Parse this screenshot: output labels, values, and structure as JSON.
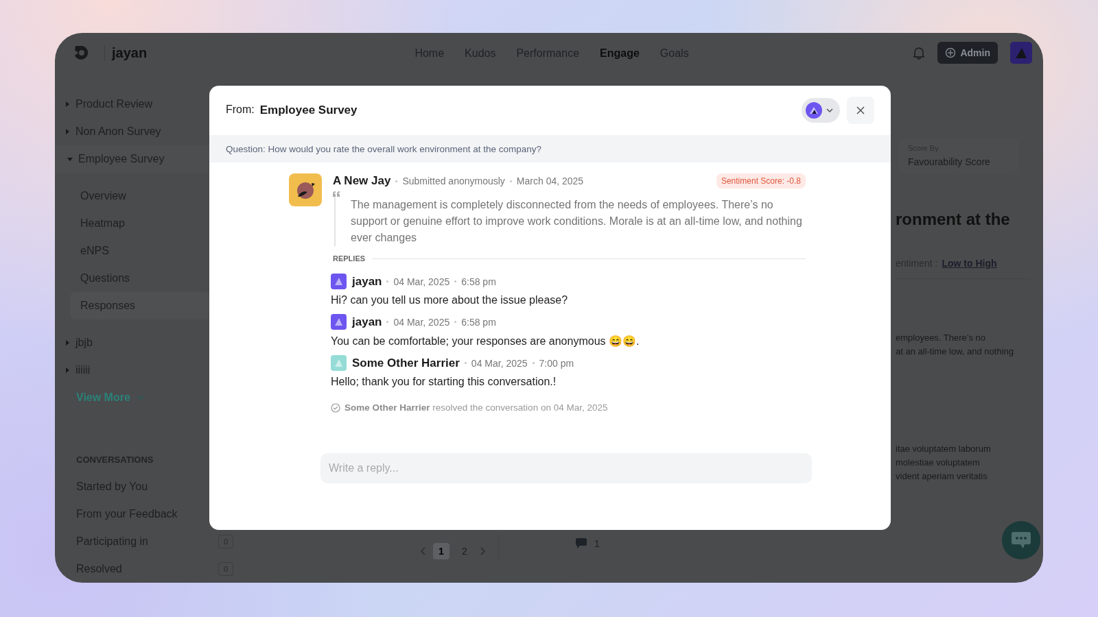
{
  "app": {
    "name": "jayan"
  },
  "nav": [
    {
      "label": "Home",
      "selected": false
    },
    {
      "label": "Kudos",
      "selected": false
    },
    {
      "label": "Performance",
      "selected": false
    },
    {
      "label": "Engage",
      "selected": true
    },
    {
      "label": "Goals",
      "selected": false
    }
  ],
  "admin_button": {
    "label": "Admin"
  },
  "sidebar": {
    "surveys": [
      {
        "label": "Product Review",
        "expanded": false
      },
      {
        "label": "Non Anon Survey",
        "expanded": false
      },
      {
        "label": "Employee Survey",
        "expanded": true,
        "children": [
          {
            "label": "Overview",
            "selected": false
          },
          {
            "label": "Heatmap",
            "selected": false
          },
          {
            "label": "eNPS",
            "selected": false
          },
          {
            "label": "Questions",
            "selected": false
          },
          {
            "label": "Responses",
            "selected": true
          }
        ]
      },
      {
        "label": "jbjb",
        "expanded": false
      },
      {
        "label": "iiiiii",
        "expanded": false
      }
    ],
    "view_more": "View More",
    "conversations_heading": "CONVERSATIONS",
    "conversations": [
      {
        "label": "Started by You"
      },
      {
        "label": "From your Feedback"
      },
      {
        "label": "Participating in",
        "count": "0"
      },
      {
        "label": "Resolved",
        "count": "0"
      }
    ]
  },
  "background_panel": {
    "score_by_label": "Score By",
    "score_by_value": "Favourability Score",
    "heading_fragment": "ronment at the",
    "sort_label": "entiment :",
    "sort_value": "Low to High",
    "text_fragments": [
      "employees. There’s no",
      "at an all-time low, and nothing"
    ],
    "text_fragments_2": [
      "itae voluptatem laborum",
      "molestiae voluptatem",
      "vident aperiam veritatis"
    ],
    "pages": [
      {
        "label": "1",
        "selected": true
      },
      {
        "label": "2",
        "selected": false
      }
    ],
    "comment_count": "1"
  },
  "modal": {
    "from_label": "From:",
    "source": "Employee Survey",
    "question": "Question: How would you rate the overall work environment at the company?",
    "response": {
      "author": "A New Jay",
      "meta": [
        "Submitted anonymously",
        "March 04, 2025"
      ],
      "sentiment": "Sentiment Score: -0.8",
      "text": "The management is completely disconnected from the needs of employees. There’s no support or genuine effort to improve work conditions. Morale is at an all-time low, and nothing ever changes"
    },
    "replies_label": "REPLIES",
    "replies": [
      {
        "author": "jayan",
        "color": "#6d55f0",
        "date": "04 Mar, 2025",
        "time": "6:58 pm",
        "text": "Hi? can you tell us more about the issue please?"
      },
      {
        "author": "jayan",
        "color": "#6d55f0",
        "date": "04 Mar, 2025",
        "time": "6:58 pm",
        "text": "You can be comfortable; your responses are anonymous 😄😄."
      },
      {
        "author": "Some Other Harrier",
        "color": "#95dcd6",
        "date": "04 Mar, 2025",
        "time": "7:00 pm",
        "text": "Hello; thank you for starting this conversation.!"
      }
    ],
    "events": [
      {
        "actor": "Some Other Harrier",
        "text": "resolved the conversation on 04 Mar, 2025"
      }
    ],
    "reply_placeholder": "Write a reply..."
  }
}
